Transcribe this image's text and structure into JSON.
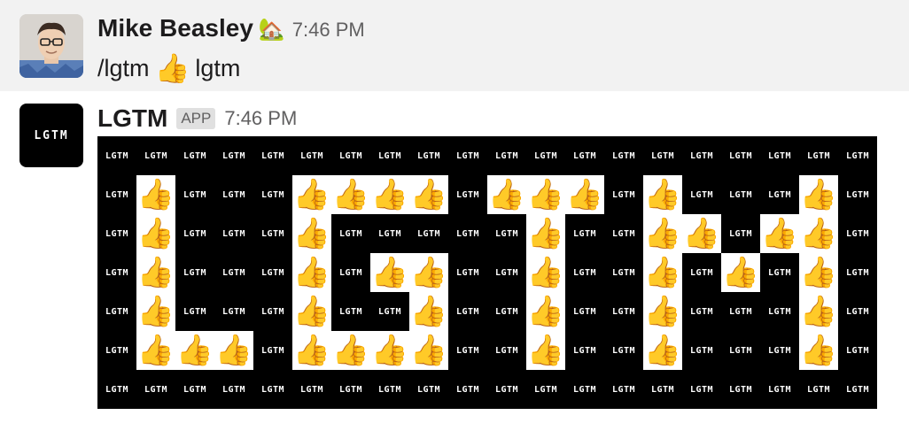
{
  "message1": {
    "author": "Mike Beasley",
    "status_emoji": "🏡",
    "time": "7:46 PM",
    "command": "/lgtm",
    "thumb": "👍",
    "text": "lgtm"
  },
  "message2": {
    "avatar_text": "LGTM",
    "author": "LGTM",
    "badge": "APP",
    "time": "7:46 PM",
    "cell_text": "LGTM",
    "cell_emoji": "👍",
    "pattern": [
      "....................",
      ".#.....####.###..#.#",
      ".#.....#.....#...####",
      ".#.....#..##.#...#.#.#",
      ".#.....#...#.#...#...#",
      ".###...####..#...#...#",
      "...................."
    ]
  }
}
